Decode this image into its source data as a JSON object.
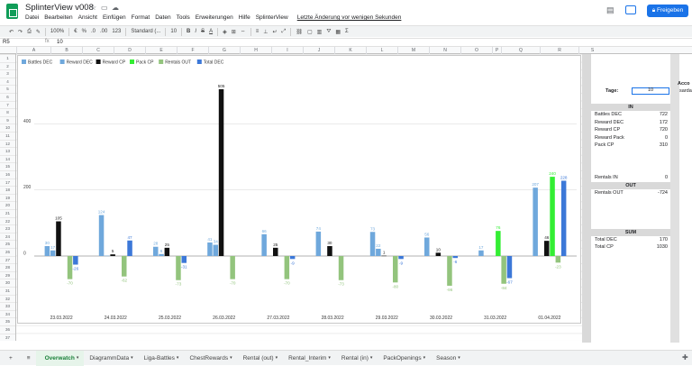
{
  "app": {
    "doc_title": "SplinterView v008",
    "menus": [
      "Datei",
      "Bearbeiten",
      "Ansicht",
      "Einfügen",
      "Format",
      "Daten",
      "Tools",
      "Erweiterungen",
      "Hilfe",
      "SplinterView"
    ],
    "last_edit": "Letzte Änderung vor wenigen Sekunden",
    "share_label": "Freigeben"
  },
  "toolbar": {
    "zoom": "100%",
    "currency": "€",
    "percent": "%",
    "dec_less": ".0",
    "dec_more": ".00",
    "number_format": "123",
    "font": "Standard (...",
    "font_size": "10",
    "bold": "B",
    "italic": "I",
    "strike": "S",
    "text_color": "A"
  },
  "formula": {
    "cell_ref": "R5",
    "value": "10"
  },
  "columns": [
    "A",
    "B",
    "C",
    "D",
    "E",
    "F",
    "G",
    "H",
    "I",
    "J",
    "K",
    "L",
    "M",
    "N",
    "O",
    "P",
    "Q",
    "R",
    "S"
  ],
  "rows": [
    "1",
    "2",
    "3",
    "4",
    "5",
    "6",
    "7",
    "8",
    "9",
    "10",
    "11",
    "12",
    "13",
    "14",
    "15",
    "16",
    "17",
    "18",
    "19",
    "20",
    "21",
    "22",
    "23",
    "24",
    "25",
    "26",
    "27",
    "28",
    "29",
    "30",
    "31",
    "32",
    "33",
    "34",
    "35",
    "36",
    "37"
  ],
  "panel": {
    "tage_label": "Tage:",
    "tage_value": "10",
    "acco": "Acco",
    "sardar": "sarda",
    "in_label": "IN",
    "in_rows": [
      {
        "label": "Battles DEC",
        "value": "722"
      },
      {
        "label": "Reward DEC",
        "value": "172"
      },
      {
        "label": "Reward CP",
        "value": "720"
      },
      {
        "label": "Reward Pack",
        "value": "0"
      },
      {
        "label": "Pack CP",
        "value": "310"
      }
    ],
    "rentals_in": {
      "label": "Rentals IN",
      "value": "0"
    },
    "out_label": "OUT",
    "rentals_out": {
      "label": "Rentals OUT",
      "value": "-724"
    },
    "sum_label": "SUM",
    "sum_rows": [
      {
        "label": "Total DEC",
        "value": "170"
      },
      {
        "label": "Total CP",
        "value": "1030"
      }
    ]
  },
  "tabs": [
    "Overwatch",
    "DiagrammData",
    "Liga-Battles",
    "ChestRewards",
    "Rental (out)",
    "Rental_Interim",
    "Rental (in)",
    "PackOpenings",
    "Season"
  ],
  "chart_data": {
    "type": "bar",
    "categories": [
      "23.03.2022",
      "24.03.2022",
      "25.03.2022",
      "26.03.2022",
      "27.03.2022",
      "28.03.2022",
      "29.03.2022",
      "30.03.2022",
      "31.03.2022",
      "01.04.2022"
    ],
    "ylim": [
      -100,
      520
    ],
    "yticks": [
      0,
      200,
      400
    ],
    "colors": [
      "#6fa8dc",
      "#6fa8dc",
      "#111111",
      "#33ee33",
      "#93c47d",
      "#3c78d8"
    ],
    "series": [
      {
        "name": "Battles DEC",
        "values": [
          30,
          124,
          28,
          41,
          66,
          74,
          73,
          56,
          17,
          207
        ]
      },
      {
        "name": "Reward DEC",
        "values": [
          17,
          1,
          6,
          34,
          0,
          0,
          22,
          0,
          0,
          0
        ]
      },
      {
        "name": "Reward CP",
        "values": [
          105,
          5,
          25,
          505,
          25,
          30,
          1,
          10,
          0,
          46
        ]
      },
      {
        "name": "Pack CP",
        "values": [
          0,
          0,
          0,
          0,
          0,
          0,
          0,
          0,
          76,
          240
        ]
      },
      {
        "name": "Rentals OUT",
        "values": [
          -70,
          -62,
          -73,
          -70,
          -70,
          -73,
          -80,
          -90,
          -84,
          -20
        ]
      },
      {
        "name": "Total DEC",
        "values": [
          -26,
          47,
          -21,
          0,
          -9,
          0,
          -9,
          -6,
          -67,
          228
        ]
      }
    ],
    "data_labels": [
      [
        "30",
        "124",
        "28",
        "41",
        "66",
        "74",
        "73",
        "56",
        "17",
        "207"
      ],
      [
        "17",
        "",
        "6",
        "34",
        "",
        "",
        "22",
        "",
        "",
        ""
      ],
      [
        "105",
        "5",
        "25",
        "505",
        "25",
        "30",
        "1",
        "10",
        "",
        "46"
      ],
      [
        "",
        "",
        "",
        "",
        "",
        "",
        "",
        "",
        "76",
        "240"
      ],
      [
        "-70",
        "-62",
        "-73",
        "-70",
        "-70",
        "-73",
        "-80",
        "-96",
        "-84",
        "-23"
      ],
      [
        "-26",
        "47",
        "-31",
        "",
        "-9",
        "",
        "-9",
        "-6",
        "-67",
        "228"
      ]
    ]
  }
}
